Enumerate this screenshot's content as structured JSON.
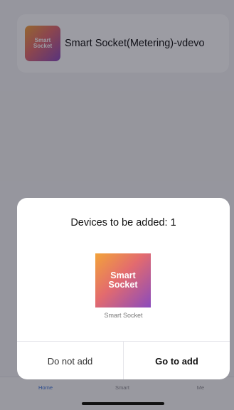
{
  "device_list": {
    "items": [
      {
        "thumb_line1": "Smart",
        "thumb_line2": "Socket",
        "name": "Smart Socket(Metering)-vdevo"
      }
    ]
  },
  "dialog": {
    "title": "Devices to be added: 1",
    "device": {
      "thumb_line1": "Smart",
      "thumb_line2": "Socket",
      "name": "Smart Socket"
    },
    "cancel_label": "Do not add",
    "confirm_label": "Go to add"
  },
  "tabbar": {
    "tabs": [
      {
        "label": "Home",
        "active": true
      },
      {
        "label": "Smart",
        "active": false
      },
      {
        "label": "Me",
        "active": false
      }
    ]
  },
  "colors": {
    "accent": "#3d74d9",
    "gradient": [
      "#f2a33a",
      "#e36b6e",
      "#8a4bbd"
    ]
  }
}
